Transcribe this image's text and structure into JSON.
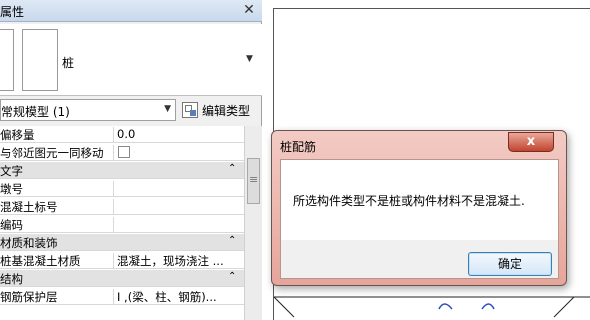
{
  "panel": {
    "title": "属性",
    "type_name": "桩",
    "filter_value": "常规模型 (1)",
    "edit_type_label": "编辑类型"
  },
  "rows": [
    {
      "kind": "prop",
      "key": "偏移量",
      "value": "0.0"
    },
    {
      "kind": "check",
      "key": "与邻近图元一同移动",
      "value": ""
    },
    {
      "kind": "hdr",
      "key": "文字",
      "value": ""
    },
    {
      "kind": "prop",
      "key": "墩号",
      "value": ""
    },
    {
      "kind": "prop",
      "key": "混凝土标号",
      "value": ""
    },
    {
      "kind": "prop",
      "key": "编码",
      "value": ""
    },
    {
      "kind": "hdr",
      "key": "材质和装饰",
      "value": ""
    },
    {
      "kind": "prop",
      "key": "桩基混凝土材质",
      "value": "混凝土，现场浇注 ..."
    },
    {
      "kind": "hdr",
      "key": "结构",
      "value": ""
    },
    {
      "kind": "prop",
      "key": "钢筋保护层",
      "value": "I ,(梁、柱、钢筋)..."
    }
  ],
  "dialog": {
    "title": "桩配筋",
    "close_glyph": "x",
    "message": "所选构件类型不是桩或构件材料不是混凝土.",
    "ok_label": "确定"
  },
  "colors": {
    "dialog_frame": "#e6a59a",
    "close_button": "#c1442f",
    "ok_border": "#3c7fb1"
  }
}
